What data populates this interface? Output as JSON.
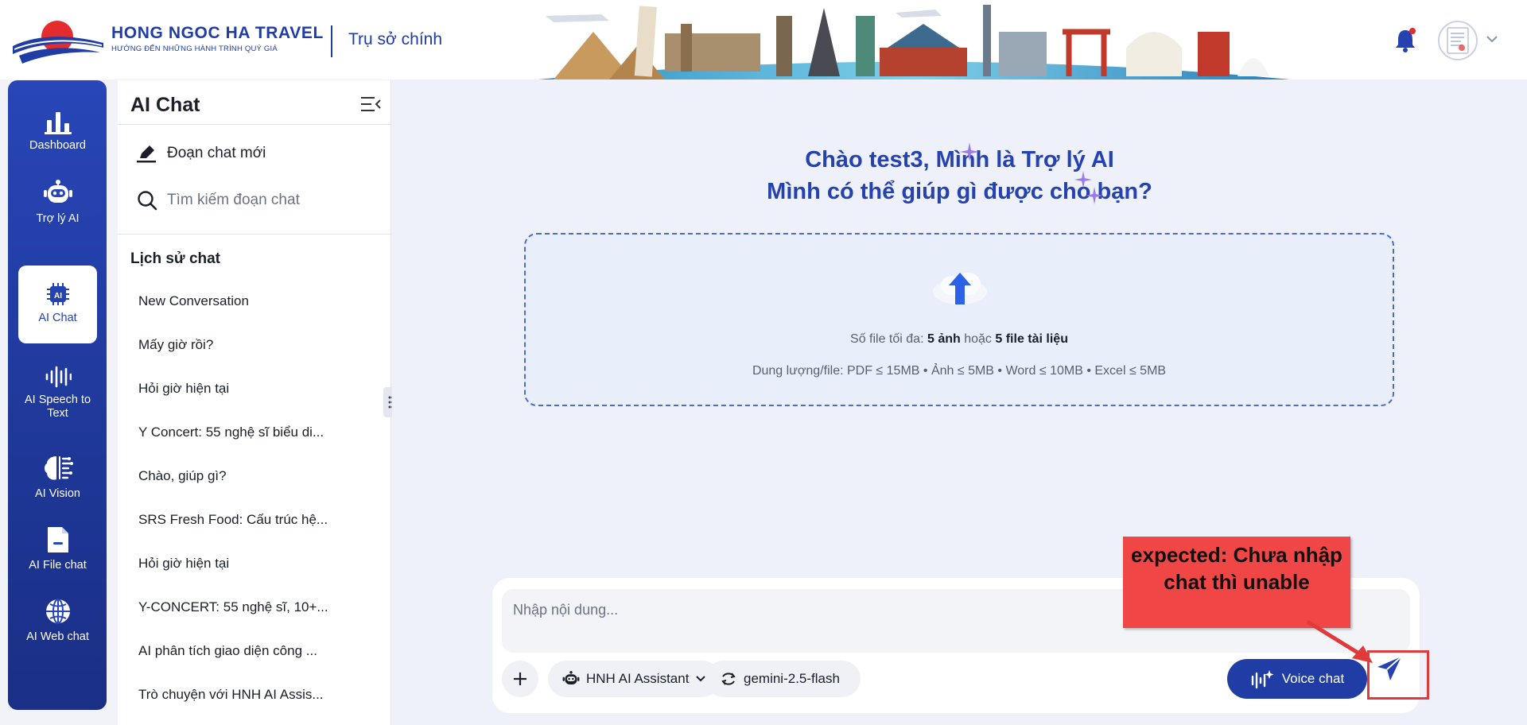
{
  "header": {
    "brand_name": "HONG NGOC HA TRAVEL",
    "brand_tagline": "HƯỚNG ĐẾN NHỮNG HÀNH TRÌNH QUÝ GIÁ",
    "office": "Trụ sở chính",
    "icons": [
      "bell-icon",
      "avatar",
      "chevron-down-icon"
    ]
  },
  "nav": {
    "items": [
      {
        "label": "Dashboard",
        "icon": "bar-chart-icon"
      },
      {
        "label": "Trợ lý AI",
        "icon": "robot-icon"
      },
      {
        "label": "AI Chat",
        "icon": "ai-chip-icon",
        "active": true
      },
      {
        "label": "AI Speech to Text",
        "icon": "waveform-icon"
      },
      {
        "label": "AI Vision",
        "icon": "brain-icon"
      },
      {
        "label": "AI File chat",
        "icon": "folder-icon"
      },
      {
        "label": "AI Web chat",
        "icon": "globe-icon"
      }
    ]
  },
  "panel": {
    "title": "AI Chat",
    "new_chat": "Đoạn chat mới",
    "search_placeholder": "Tìm kiếm đoạn chat",
    "history_title": "Lịch sử chat",
    "history": [
      "New Conversation",
      "Mấy giờ rồi?",
      "Hỏi giờ hiện tại",
      "Y Concert: 55 nghệ sĩ biểu di...",
      "Chào, giúp gì?",
      "SRS Fresh Food: Cấu trúc hệ...",
      "Hỏi giờ hiện tại",
      "Y-CONCERT: 55 nghệ sĩ, 10+...",
      "AI phân tích giao diện công ...",
      "Trò chuyện với HNH AI Assis..."
    ]
  },
  "main": {
    "greeting_line1": "Chào test3, Mình là Trợ lý AI",
    "greeting_line2": "Mình có thể giúp gì được cho bạn?",
    "upload": {
      "limit_prefix": "Số file tối đa:",
      "limit_images": "5 ảnh",
      "limit_or": "hoặc",
      "limit_docs": "5 file tài liệu",
      "sizes": "Dung lượng/file: PDF ≤ 15MB • Ảnh ≤ 5MB • Word ≤ 10MB • Excel ≤ 5MB"
    },
    "composer": {
      "placeholder": "Nhập nội dung...",
      "assistant": "HNH AI Assistant",
      "model": "gemini-2.5-flash",
      "voice": "Voice chat"
    }
  },
  "annotation": {
    "text": "expected: Chưa nhập chat thì unable",
    "color": "#f04646"
  },
  "colors": {
    "brand": "#1f3da5",
    "nav_bg": "#2846b8",
    "accent_red": "#e13a3a"
  }
}
